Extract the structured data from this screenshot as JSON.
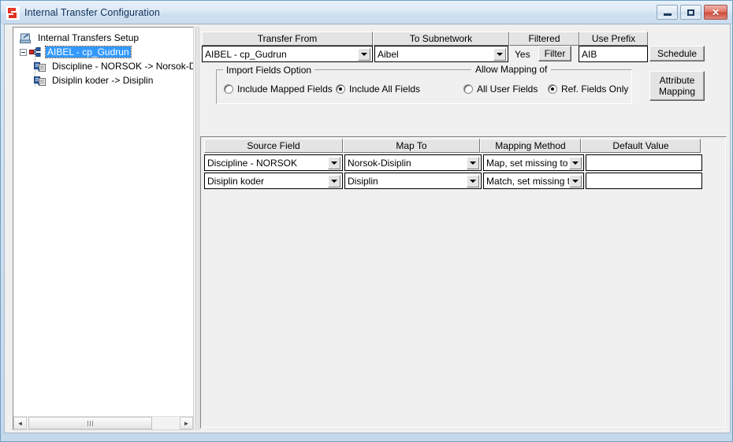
{
  "window": {
    "title": "Internal Transfer Configuration",
    "app_icon": "app-logo-icon",
    "buttons": {
      "minimize": "minimize-icon",
      "maximize": "maximize-icon",
      "close": "✕"
    }
  },
  "tree": {
    "root_label": "Internal Transfers Setup",
    "nodes": [
      {
        "label": "AIBEL - cp_Gudrun",
        "selected": true,
        "level": 2,
        "expanded": true
      },
      {
        "label": "Discipline - NORSOK -> Norsok-D",
        "selected": false,
        "level": 3
      },
      {
        "label": "Disiplin koder -> Disiplin",
        "selected": false,
        "level": 3
      }
    ],
    "scrollbar": {
      "left_arrow": "◄",
      "right_arrow": "►"
    }
  },
  "top_panel": {
    "headers": {
      "transfer_from": "Transfer From",
      "to_subnetwork": "To Subnetwork",
      "filtered": "Filtered",
      "use_prefix": "Use Prefix"
    },
    "transfer_from_value": "AIBEL - cp_Gudrun",
    "to_subnetwork_value": "Aibel",
    "filtered_value": "Yes",
    "filter_button": "Filter",
    "use_prefix_value": "AIB",
    "schedule_button": "Schedule",
    "attribute_mapping_button": "Attribute\nMapping",
    "import_fields_group": "Import Fields Option",
    "allow_mapping_group": "Allow Mapping of",
    "radios": {
      "include_mapped_fields": {
        "label": "Include Mapped Fields",
        "checked": false
      },
      "include_all_fields": {
        "label": "Include All Fields",
        "checked": true
      },
      "all_user_fields": {
        "label": "All User Fields",
        "checked": false
      },
      "ref_fields_only": {
        "label": "Ref. Fields Only",
        "checked": true
      }
    }
  },
  "grid": {
    "columns": [
      "Source Field",
      "Map To",
      "Mapping Method",
      "Default Value"
    ],
    "rows": [
      {
        "source_field": "Discipline - NORSOK",
        "map_to": "Norsok-Disiplin",
        "mapping_method": "Map, set missing to <",
        "default_value": ""
      },
      {
        "source_field": "Disiplin koder",
        "map_to": "Disiplin",
        "mapping_method": "Match, set missing to",
        "default_value": ""
      }
    ]
  },
  "colors": {
    "selection_blue": "#3399ff",
    "title_bar": "#dbe9f6",
    "face": "#f0f0f0",
    "close_red": "#cf4a3a"
  }
}
